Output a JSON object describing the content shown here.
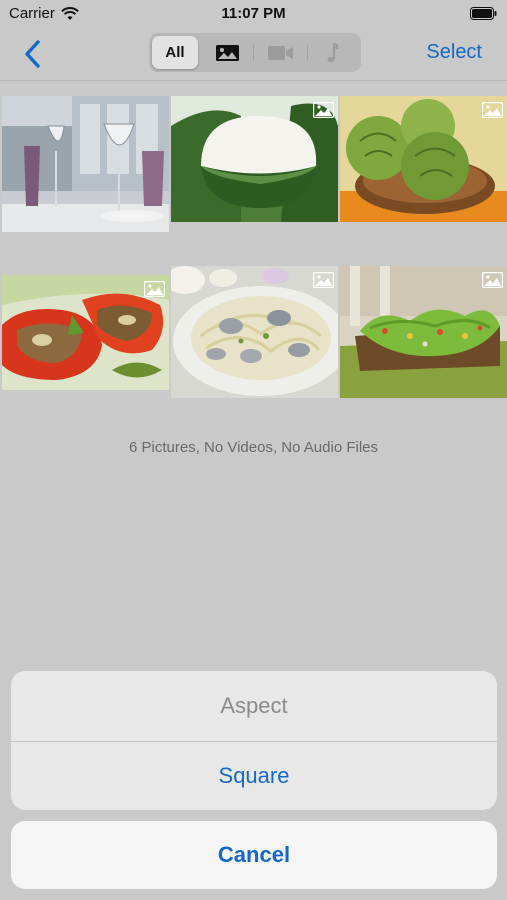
{
  "status_bar": {
    "carrier": "Carrier",
    "time": "11:07 PM",
    "wifi_icon": "wifi-icon",
    "battery_icon": "battery-icon"
  },
  "nav": {
    "back_icon": "chevron-left-icon",
    "segments": [
      {
        "label": "All",
        "selected": true
      },
      {
        "icon": "photo-icon",
        "enabled": true
      },
      {
        "icon": "video-icon",
        "enabled": false
      },
      {
        "icon": "music-note-icon",
        "enabled": false
      }
    ],
    "select_label": "Select"
  },
  "grid": {
    "items": [
      {
        "subject": "wine glasses on table",
        "badge": null
      },
      {
        "subject": "white dessert in leaf cup",
        "badge": "photo-icon"
      },
      {
        "subject": "artichokes in bowl",
        "badge": "photo-icon"
      },
      {
        "subject": "stuffed red peppers",
        "badge": "photo-icon"
      },
      {
        "subject": "pasta with clams",
        "badge": "photo-icon"
      },
      {
        "subject": "lettuce wraps on platter",
        "badge": "photo-icon"
      }
    ]
  },
  "summary": "6 Pictures, No Videos, No Audio Files",
  "action_sheet": {
    "title": "Aspect",
    "options": [
      "Square"
    ],
    "cancel_label": "Cancel"
  },
  "colors": {
    "accent": "#1568c7",
    "background_dim": "#c9c9c9",
    "sheet": "#e8e8e8"
  }
}
